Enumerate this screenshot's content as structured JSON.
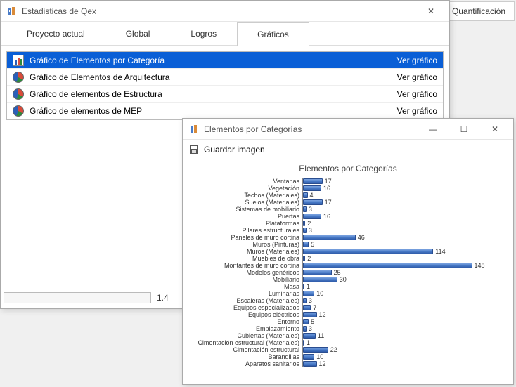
{
  "background_tab_label": "Quantificación",
  "main_window": {
    "title": "Estadisticas de Qex",
    "tabs": [
      "Proyecto actual",
      "Global",
      "Logros",
      "Gráficos"
    ],
    "active_tab_index": 3,
    "action_label": "Ver gráfico",
    "rows": [
      {
        "icon": "bar",
        "label": "Gráfico de Elementos por Categoría",
        "selected": true
      },
      {
        "icon": "pie",
        "label": "Gráfico de Elementos de Arquitectura",
        "selected": false
      },
      {
        "icon": "pie",
        "label": "Gráfico de elementos de Estructura",
        "selected": false
      },
      {
        "icon": "pie",
        "label": "Gráfico de elementos de MEP",
        "selected": false
      }
    ],
    "status_text": "1.4"
  },
  "child_window": {
    "title": "Elementos por Categorías",
    "save_label": "Guardar imagen"
  },
  "chart_data": {
    "type": "bar",
    "orientation": "horizontal",
    "title": "Elementos por Categorías",
    "xlabel": "",
    "ylabel": "",
    "xmax": 160,
    "categories": [
      "Ventanas",
      "Vegetación",
      "Techos (Materiales)",
      "Suelos (Materiales)",
      "Sistemas de mobiliario",
      "Puertas",
      "Plataformas",
      "Pilares estructurales",
      "Paneles de muro cortina",
      "Muros (Pinturas)",
      "Muros (Materiales)",
      "Muebles de obra",
      "Montantes de muro cortina",
      "Modelos genéricos",
      "Mobiliario",
      "Masa",
      "Luminarias",
      "Escaleras (Materiales)",
      "Equipos especializados",
      "Equipos eléctricos",
      "Entorno",
      "Emplazamiento",
      "Cubiertas (Materiales)",
      "Cimentación estructural (Materiales)",
      "Cimentación estructural",
      "Barandillas",
      "Aparatos sanitarios"
    ],
    "values": [
      17,
      16,
      4,
      17,
      3,
      16,
      2,
      3,
      46,
      5,
      114,
      2,
      148,
      25,
      30,
      1,
      10,
      3,
      7,
      12,
      5,
      3,
      11,
      1,
      22,
      10,
      12
    ]
  }
}
